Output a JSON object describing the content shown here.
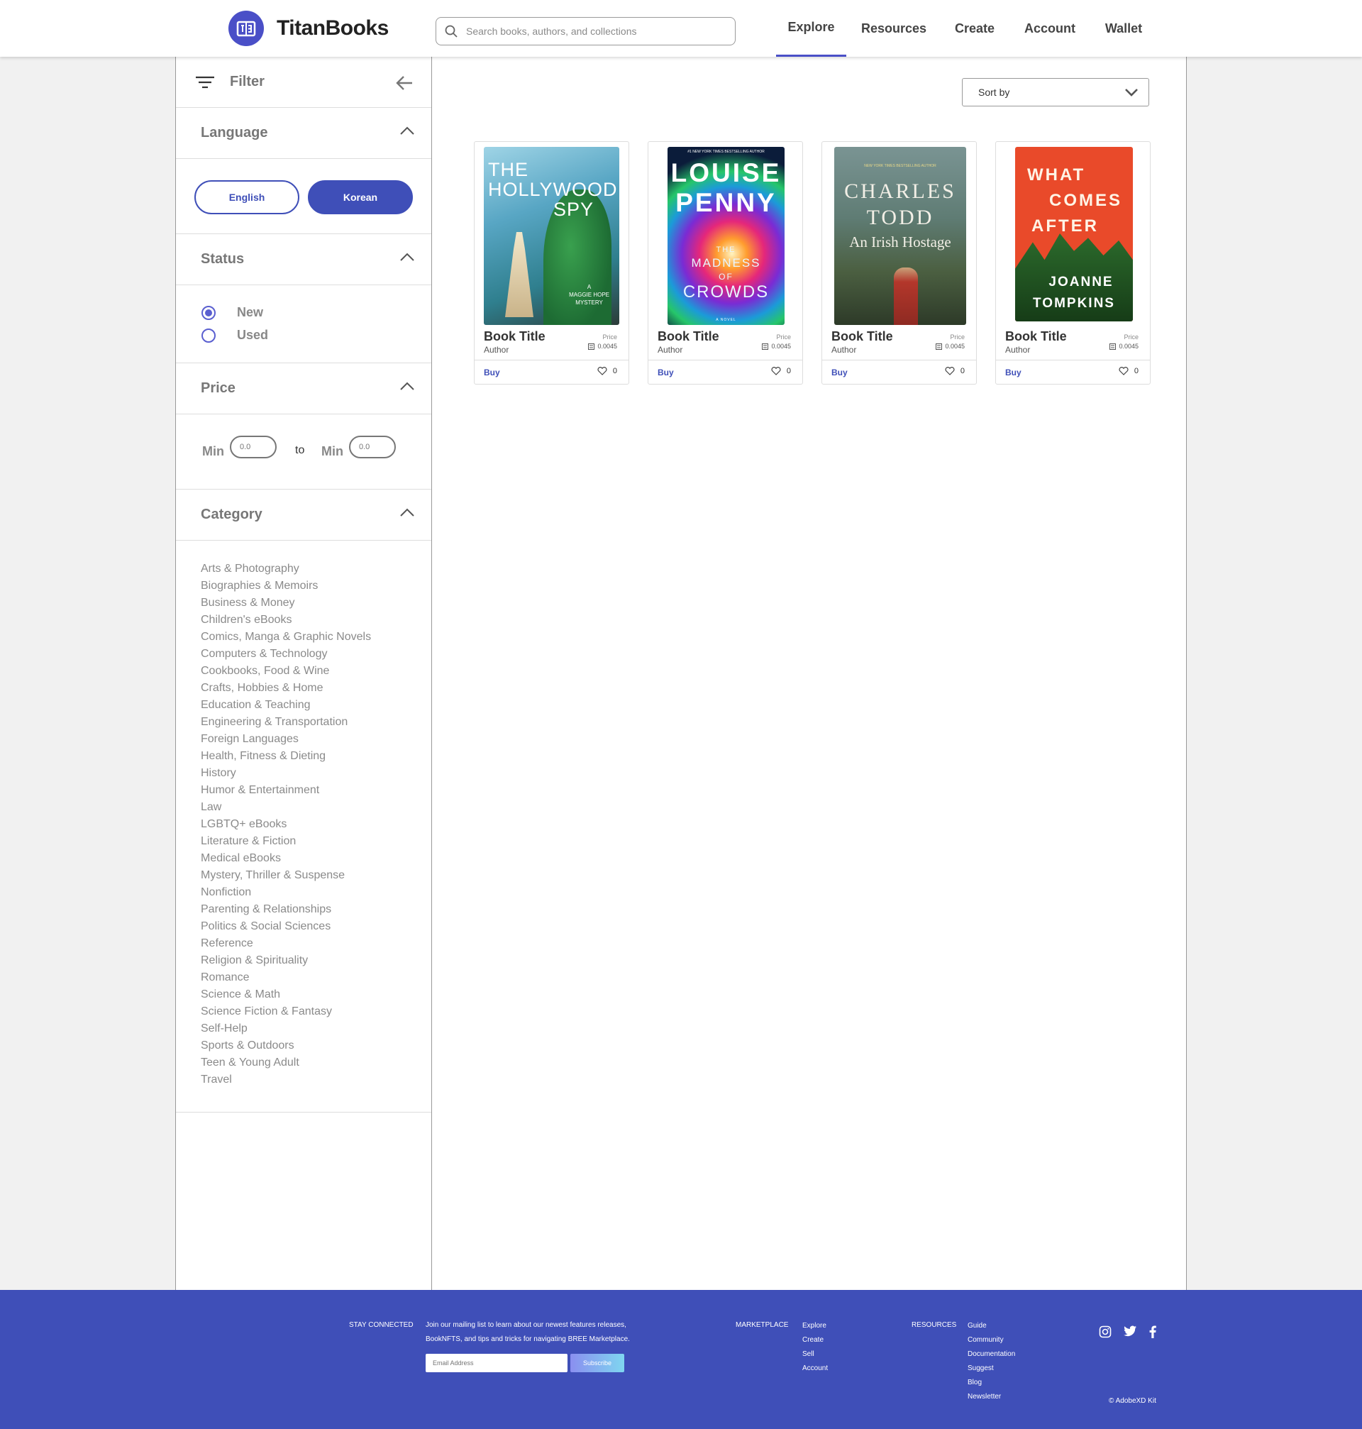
{
  "brand": {
    "name": "TitanBooks",
    "accent": "#3f4fb8"
  },
  "search": {
    "placeholder": "Search books, authors, and collections"
  },
  "nav": {
    "items": [
      "Explore",
      "Resources",
      "Create",
      "Account",
      "Wallet"
    ],
    "active": "Explore"
  },
  "filter": {
    "title": "Filter",
    "language": {
      "title": "Language",
      "options": [
        "English",
        "Korean"
      ],
      "selected": "Korean"
    },
    "status": {
      "title": "Status",
      "options": [
        "New",
        "Used"
      ],
      "selected": "New"
    },
    "price": {
      "title": "Price",
      "min_label": "Min",
      "to_label": "to",
      "max_label": "Min",
      "min_placeholder": "0.0",
      "max_placeholder": "0.0"
    },
    "category": {
      "title": "Category",
      "items": [
        "Arts & Photography",
        "Biographies & Memoirs",
        "Business & Money",
        "Children's eBooks",
        "Comics, Manga & Graphic Novels",
        "Computers & Technology",
        "Cookbooks, Food & Wine",
        "Crafts, Hobbies & Home",
        "Education & Teaching",
        "Engineering & Transportation",
        "Foreign Languages",
        "Health, Fitness & Dieting",
        "History",
        "Humor & Entertainment",
        "Law",
        "LGBTQ+ eBooks",
        "Literature & Fiction",
        "Medical eBooks",
        "Mystery, Thriller & Suspense",
        "Nonfiction",
        "Parenting & Relationships",
        "Politics & Social Sciences",
        "Reference",
        "Religion & Spirituality",
        "Romance",
        "Science & Math",
        "Science Fiction & Fantasy",
        "Self-Help",
        "Sports & Outdoors",
        "Teen & Young Adult",
        "Travel"
      ]
    }
  },
  "sort": {
    "label": "Sort by"
  },
  "books": [
    {
      "title": "Book Title",
      "author": "Author",
      "price_label": "Price",
      "price": "0.0045",
      "buy": "Buy",
      "likes": "0",
      "cover": {
        "title_lines": [
          "THE",
          "HOLLYWOOD",
          "SPY"
        ],
        "side_text": [
          "A",
          "MAGGIE HOPE",
          "MYSTERY"
        ]
      }
    },
    {
      "title": "Book Title",
      "author": "Author",
      "price_label": "Price",
      "price": "0.0045",
      "buy": "Buy",
      "likes": "0",
      "cover": {
        "top_text": "#1 NEW YORK TIMES BESTSELLING AUTHOR",
        "author_lines": [
          "LOUISE",
          "PENNY"
        ],
        "title_lines": [
          "THE",
          "MADNESS",
          "OF",
          "CROWDS"
        ],
        "bottom_text": "A NOVEL"
      }
    },
    {
      "title": "Book Title",
      "author": "Author",
      "price_label": "Price",
      "price": "0.0045",
      "buy": "Buy",
      "likes": "0",
      "cover": {
        "top_text": "NEW YORK TIMES BESTSELLING AUTHOR",
        "author_lines": [
          "CHARLES",
          "TODD"
        ],
        "title": "An Irish Hostage"
      }
    },
    {
      "title": "Book Title",
      "author": "Author",
      "price_label": "Price",
      "price": "0.0045",
      "buy": "Buy",
      "likes": "0",
      "cover": {
        "title_lines": [
          "WHAT",
          "COMES",
          "AFTER"
        ],
        "author_lines": [
          "JOANNE",
          "TOMPKINS"
        ]
      }
    }
  ],
  "footer": {
    "stay_connected": "STAY CONNECTED",
    "mailing_text": [
      "Join our mailing list to learn about our newest features releases,",
      "BookNFTS, and tips and tricks for navigating BREE Marketplace."
    ],
    "email_placeholder": "Email Address",
    "subscribe": "Subscribe",
    "marketplace": {
      "title": "MARKETPLACE",
      "links": [
        "Explore",
        "Create",
        "Sell",
        "Account"
      ]
    },
    "resources": {
      "title": "RESOURCES",
      "links": [
        "Guide",
        "Community",
        "Documentation",
        "Suggest",
        "Blog",
        "Newsletter"
      ]
    },
    "social_icons": [
      "instagram-icon",
      "twitter-icon",
      "facebook-icon"
    ],
    "copyright": "© AdobeXD Kit"
  }
}
